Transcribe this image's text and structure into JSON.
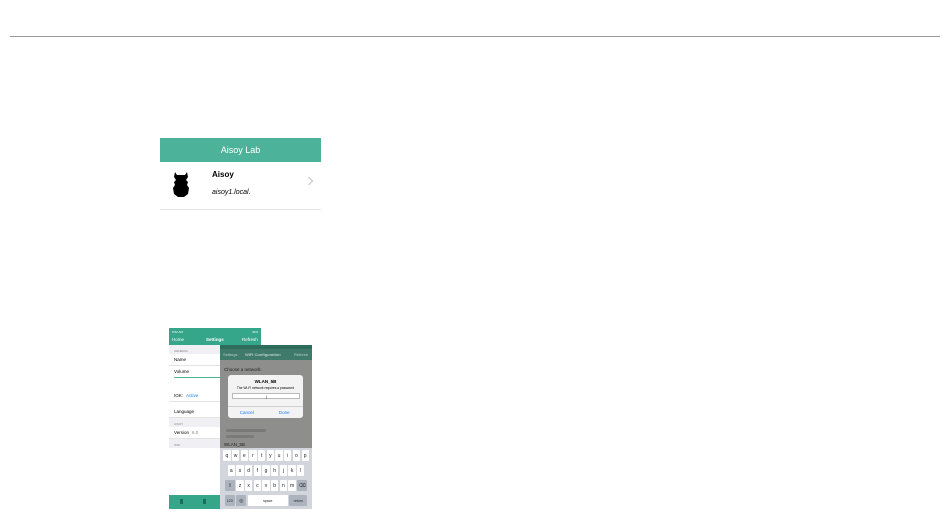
{
  "card": {
    "header": "Aisoy Lab",
    "device_name": "Aisoy",
    "device_host": "aisoy1.local."
  },
  "settings_screen": {
    "status_time": "9:52 AM",
    "status_battery": "46%",
    "nav": {
      "left": "Home",
      "title": "Settings",
      "right": "Refresh"
    },
    "sections": {
      "general": "GENERAL",
      "aisoy": "AISOY",
      "wifi": "WIFI"
    },
    "cells": {
      "name": "Name",
      "volume": "Volume",
      "iok": "IOK:",
      "iok_value": "Active",
      "language": "Language",
      "version": "Version",
      "version_value": "6.0"
    }
  },
  "wifi_screen": {
    "nav": {
      "left": "Settings",
      "title": "WiFi Configuration",
      "right": "Refresh"
    },
    "choose": "Choose a network:",
    "selected_network": "WLAN_5B",
    "dialog": {
      "title": "WLAN_5B",
      "message": "The Wi-Fi network requires a password",
      "password_value": "|",
      "cancel": "Cancel",
      "done": "Done"
    },
    "keyboard": {
      "row1": [
        "q",
        "w",
        "e",
        "r",
        "t",
        "y",
        "u",
        "i",
        "o",
        "p"
      ],
      "row2": [
        "a",
        "s",
        "d",
        "f",
        "g",
        "h",
        "j",
        "k",
        "l"
      ],
      "row3": [
        "z",
        "x",
        "c",
        "v",
        "b",
        "n",
        "m"
      ],
      "num": "123",
      "space": "space",
      "return": "return"
    }
  },
  "colors": {
    "accent": "#4cb39a",
    "nav_dark": "#35a68a",
    "link": "#1a7cf0"
  }
}
